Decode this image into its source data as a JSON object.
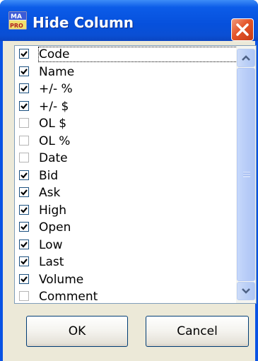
{
  "window": {
    "title": "Hide Column",
    "icon": "app-icon",
    "close_icon": "close-icon"
  },
  "columns": [
    {
      "label": "Code",
      "checked": true,
      "focused": true
    },
    {
      "label": "Name",
      "checked": true
    },
    {
      "label": "+/- %",
      "checked": true
    },
    {
      "label": "+/- $",
      "checked": true
    },
    {
      "label": "OL $",
      "checked": false
    },
    {
      "label": "OL %",
      "checked": false
    },
    {
      "label": "Date",
      "checked": false
    },
    {
      "label": "Bid",
      "checked": true
    },
    {
      "label": "Ask",
      "checked": true
    },
    {
      "label": "High",
      "checked": true
    },
    {
      "label": "Open",
      "checked": true
    },
    {
      "label": "Low",
      "checked": true
    },
    {
      "label": "Last",
      "checked": true
    },
    {
      "label": "Volume",
      "checked": true
    },
    {
      "label": "Comment",
      "checked": false
    }
  ],
  "scrollbar": {
    "up_icon": "chevron-up-icon",
    "down_icon": "chevron-down-icon"
  },
  "buttons": {
    "ok_label": "OK",
    "cancel_label": "Cancel"
  },
  "colors": {
    "titlebar": "#0650dc",
    "close_button": "#e4552a",
    "client_background": "#ece9d8",
    "checkmark": "#21a121"
  }
}
